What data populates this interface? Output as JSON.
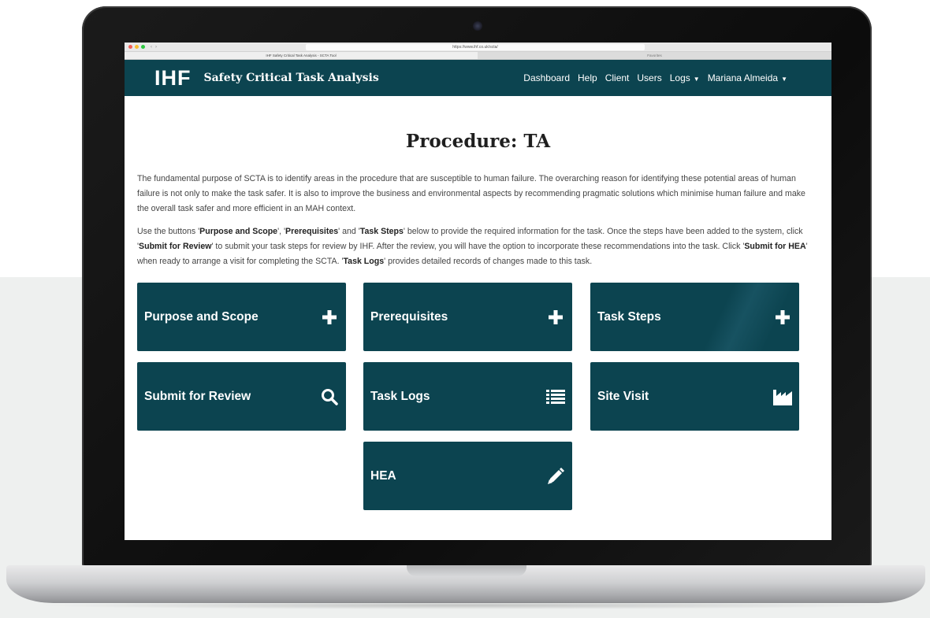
{
  "browser": {
    "url": "https://www.ihf.co.uk/scta/",
    "active_tab": "IHF Safety Critical Task Analysis - SCTA Tool",
    "inactive_tab": "Favorites"
  },
  "header": {
    "logo": "IHF",
    "title": "Safety Critical Task Analysis",
    "nav": {
      "dashboard": "Dashboard",
      "help": "Help",
      "client": "Client",
      "users": "Users",
      "logs": "Logs",
      "user": "Mariana Almeida"
    }
  },
  "main": {
    "title": "Procedure: TA",
    "intro": "The fundamental purpose of SCTA is to identify areas in the procedure that are susceptible to human failure. The overarching reason for identifying these potential areas of human failure is not only to make the task safer. It is also to improve the business and environmental aspects by recommending pragmatic solutions which minimise human failure and make the overall task safer and more efficient in an MAH context.",
    "instructions": {
      "t1": "Use the buttons '",
      "b1": "Purpose and Scope",
      "t2": "', '",
      "b2": "Prerequisites",
      "t3": "' and '",
      "b3": "Task Steps",
      "t4": "' below to provide the required information for the task. Once the steps have been added to the system, click '",
      "b4": "Submit for Review",
      "t5": "' to submit your task steps for review by IHF. After the review, you will have the option to incorporate these recommendations into the task. Click '",
      "b5": "Submit for HEA",
      "t6": "' when ready to arrange a visit for completing the SCTA. '",
      "b6": "Task Logs",
      "t7": "' provides detailed records of changes made to this task."
    },
    "tiles": [
      {
        "label": "Purpose and Scope",
        "icon": "plus-icon"
      },
      {
        "label": "Prerequisites",
        "icon": "plus-icon"
      },
      {
        "label": "Task Steps",
        "icon": "plus-icon"
      },
      {
        "label": "Submit for Review",
        "icon": "search-icon"
      },
      {
        "label": "Task Logs",
        "icon": "list-icon"
      },
      {
        "label": "Site Visit",
        "icon": "factory-icon"
      },
      {
        "label": "HEA",
        "icon": "pencil-icon"
      }
    ]
  },
  "colors": {
    "brand": "#0c4450",
    "text": "#444444"
  }
}
